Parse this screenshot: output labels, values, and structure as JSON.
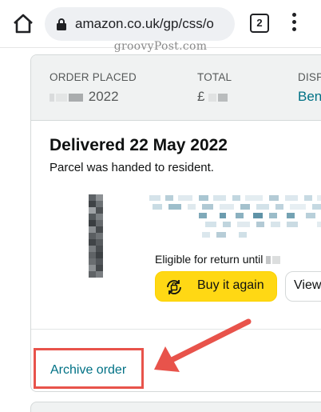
{
  "browser": {
    "url": "amazon.co.uk/gp/css/o",
    "tab_count": "2",
    "icons": [
      "home-icon",
      "lock-icon",
      "more-vert-icon"
    ]
  },
  "watermark": "groovyPost.com",
  "order": {
    "placed_label": "ORDER PLACED",
    "placed_value": "2022",
    "total_label": "TOTAL",
    "total_currency": "£",
    "dispatch_label": "DISP",
    "dispatch_value": "Ben",
    "status": "Delivered 22 May 2022",
    "substatus": "Parcel was handed to resident.",
    "eligible_text": "Eligible for return until",
    "buy_again_label": "Buy it again",
    "view_label": "View",
    "archive_label": "Archive order"
  },
  "colors": {
    "header_bg": "#f0f2f2",
    "link": "#007185",
    "buy_button": "#ffd814",
    "highlight": "#e8534b"
  }
}
